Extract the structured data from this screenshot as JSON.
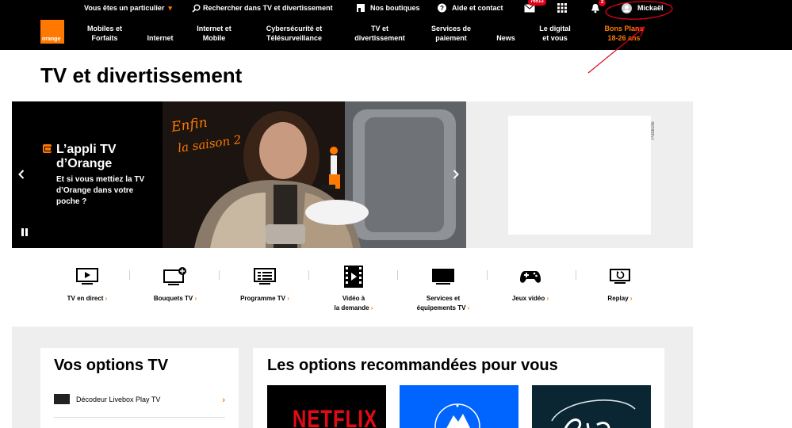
{
  "utility_bar": {
    "profile_selector": "Vous êtes un particulier",
    "search_label": "Rechercher dans TV et divertissement",
    "shops_label": "Nos boutiques",
    "help_label": "Aide et contact",
    "mail_count": "76513",
    "notif_count": "2",
    "user_name": "Mickaël"
  },
  "logo_text": "orange",
  "nav": [
    {
      "label": "Mobiles et\nForfaits"
    },
    {
      "label": "Internet"
    },
    {
      "label": "Internet et\nMobile"
    },
    {
      "label": "Cybersécurité et\nTélésurveillance"
    },
    {
      "label": "TV et\ndivertissement"
    },
    {
      "label": "Services de\npaiement"
    },
    {
      "label": "News"
    },
    {
      "label": "Le digital\net vous"
    },
    {
      "label": "Bons Plans\n18-26 ans"
    }
  ],
  "page_title": "TV et divertissement",
  "hero": {
    "title": "L’appli TV d’Orange",
    "subtitle": "Et si vous mettiez la TV d’Orange dans votre poche ?",
    "script_text_1": "Enfin",
    "script_text_2": "la saison 2"
  },
  "ad_label": "Publicité",
  "categories": [
    {
      "label": "TV en direct",
      "icon": "tv-live-icon"
    },
    {
      "label": "Bouquets TV",
      "icon": "tv-bouquet-icon"
    },
    {
      "label": "Programme TV",
      "icon": "tv-guide-icon"
    },
    {
      "label": "Vidéo à\nla demande",
      "icon": "film-icon"
    },
    {
      "label": "Services et\néquipements TV",
      "icon": "tv-box-icon"
    },
    {
      "label": "Jeux vidéo",
      "icon": "gamepad-icon"
    },
    {
      "label": "Replay",
      "icon": "replay-icon"
    }
  ],
  "options": {
    "title": "Vos options TV",
    "first_item": "Décodeur Livebox Play TV"
  },
  "recommended": {
    "title": "Les options recommandées pour vous",
    "netflix_label": "NETFLIX"
  },
  "colors": {
    "brand_orange": "#ff7900",
    "header_bg": "#000000",
    "annotation_red": "#e2001a"
  }
}
